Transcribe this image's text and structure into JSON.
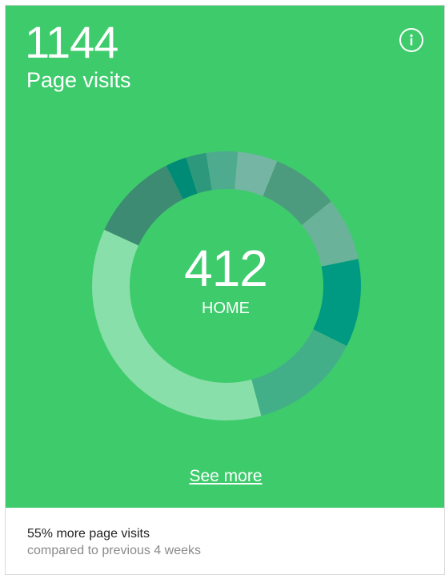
{
  "card": {
    "value": "1144",
    "label": "Page visits",
    "center_value": "412",
    "center_label": "HOME",
    "see_more_label": "See more",
    "footer_title": "55% more page visits",
    "footer_subtitle": "compared to previous 4 weeks"
  },
  "icons": {
    "info": "info-icon"
  },
  "colors": {
    "panel_background": "#3ecb6c",
    "text_on_panel": "#ffffff",
    "footer_title": "#222222",
    "footer_subtitle": "#8a8a8a"
  },
  "chart_data": {
    "type": "pie",
    "donut": true,
    "categories": [
      "HOME",
      "",
      "",
      "",
      "",
      "",
      "",
      "",
      "",
      ""
    ],
    "values": [
      412,
      123,
      29,
      28,
      43,
      55,
      92,
      87,
      121,
      154
    ],
    "colors": [
      "#88dfa9",
      "#3c8b72",
      "#008b76",
      "#2d987c",
      "#4eab8e",
      "#74b5a4",
      "#4d9b7e",
      "#6ab29a",
      "#009a82",
      "#43af88"
    ]
  }
}
